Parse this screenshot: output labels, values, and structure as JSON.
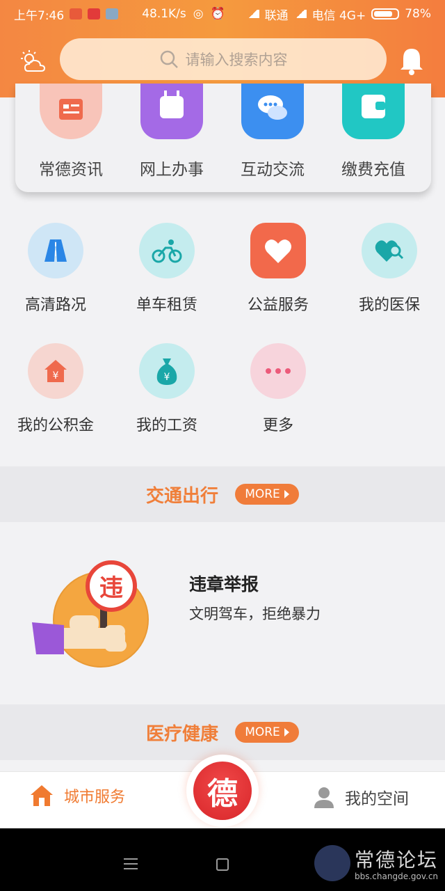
{
  "status_bar": {
    "time": "上午7:46",
    "speed": "48.1K/s",
    "carrier1": "联通",
    "carrier2": "电信 4G+",
    "battery": "78%"
  },
  "header": {
    "search_placeholder": "请输入搜索内容",
    "weather_icon": "weather-icon",
    "bell_icon": "bell-icon",
    "accent_color": "#f48a3d"
  },
  "top_services": [
    {
      "label": "常德资讯",
      "icon": "news-icon",
      "color": "#f7b2a6"
    },
    {
      "label": "网上办事",
      "icon": "calendar-icon",
      "color": "#a36ee8"
    },
    {
      "label": "互动交流",
      "icon": "chat-icon",
      "color": "#3b8ff0"
    },
    {
      "label": "缴费充值",
      "icon": "wallet-icon",
      "color": "#22c6c6"
    }
  ],
  "grid_services": [
    {
      "label": "高清路况",
      "icon": "road-icon",
      "bg": "#cfe6f6"
    },
    {
      "label": "单车租赁",
      "icon": "bike-icon",
      "bg": "#c4ecee"
    },
    {
      "label": "公益服务",
      "icon": "heart-icon",
      "bg": "#f2694b"
    },
    {
      "label": "我的医保",
      "icon": "medical-search-icon",
      "bg": "#c4ecee"
    },
    {
      "label": "我的公积金",
      "icon": "fund-house-icon",
      "bg": "#f6d6d0"
    },
    {
      "label": "我的工资",
      "icon": "money-bag-icon",
      "bg": "#c4ecee"
    },
    {
      "label": "更多",
      "icon": "more-dots-icon",
      "bg": "#f7d4dc"
    }
  ],
  "sections": {
    "traffic": {
      "title": "交通出行",
      "more": "MORE"
    },
    "health": {
      "title": "医疗健康",
      "more": "MORE"
    }
  },
  "promo": {
    "title": "违章举报",
    "subtitle": "文明驾车，拒绝暴力",
    "badge_char": "违"
  },
  "tabbar": {
    "left_label": "城市服务",
    "center_char": "德",
    "right_label": "我的空间"
  },
  "watermark": {
    "text": "常德论坛",
    "url": "bbs.changde.gov.cn"
  }
}
